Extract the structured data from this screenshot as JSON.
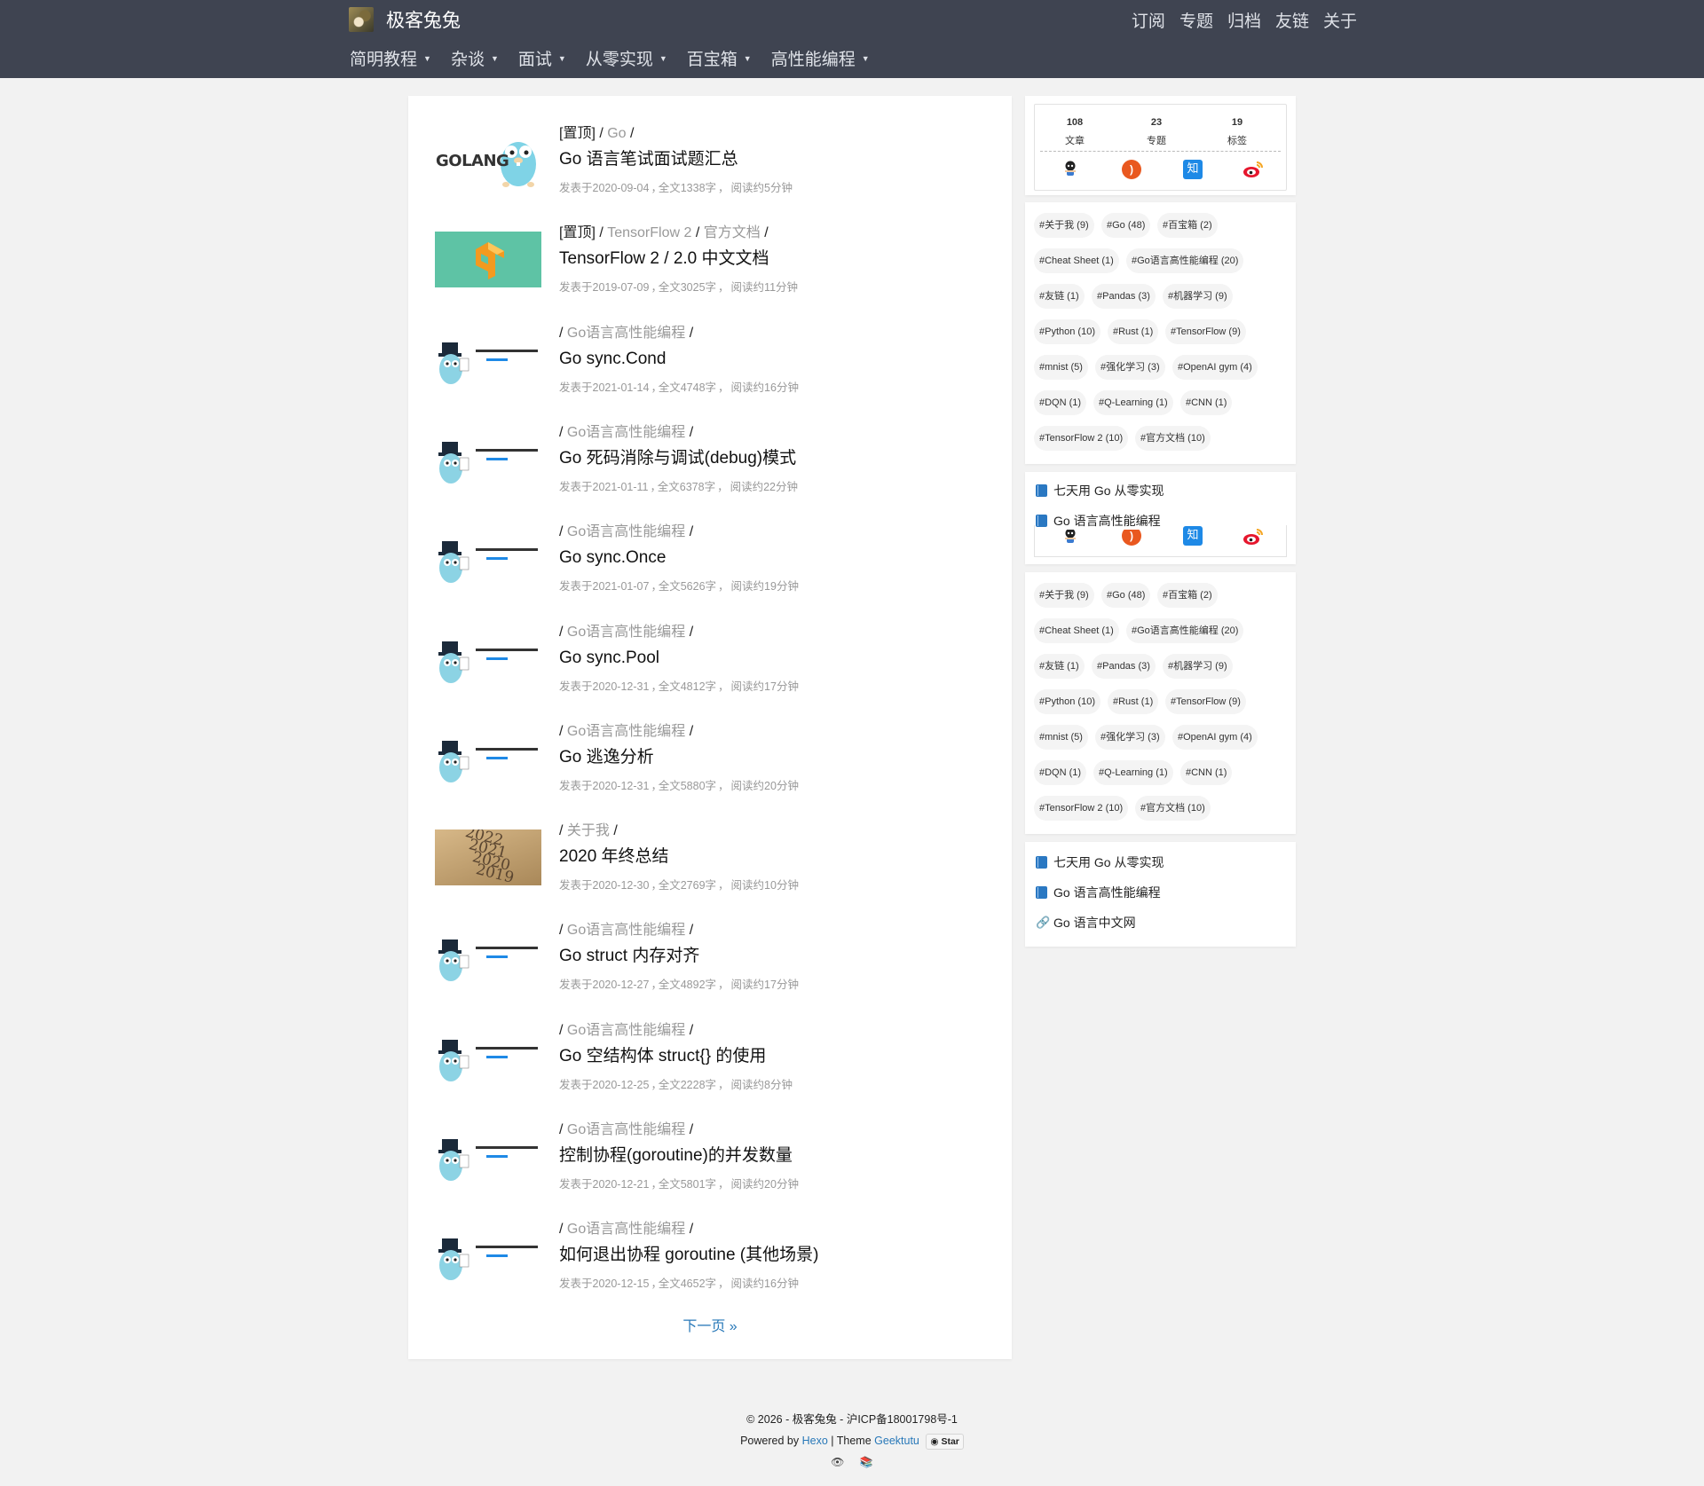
{
  "header": {
    "site_name": "极客兔兔",
    "top_links": [
      "订阅",
      "专题",
      "归档",
      "友链",
      "关于"
    ],
    "menu": [
      "简明教程",
      "杂谈",
      "面试",
      "从零实现",
      "百宝箱",
      "高性能编程"
    ],
    "caret": "▼"
  },
  "posts": [
    {
      "prefix": "[置顶] / ",
      "cats": [
        "Go"
      ],
      "title": "Go 语言笔试面试题汇总",
      "date": "发表于2020-09-04",
      "words": "全文1338字",
      "read": "阅读约5分钟",
      "thumb": "golang",
      "thumb_text": "GOLANG"
    },
    {
      "prefix": "[置顶] / ",
      "cats": [
        "TensorFlow 2",
        "官方文档"
      ],
      "title": "TensorFlow 2 / 2.0 中文文档",
      "date": "发表于2019-07-09",
      "words": "全文3025字",
      "read": "阅读约11分钟",
      "thumb": "tensorflow"
    },
    {
      "prefix": "/ ",
      "cats": [
        "Go语言高性能编程"
      ],
      "title": "Go sync.Cond",
      "date": "发表于2021-01-14",
      "words": "全文4748字",
      "read": "阅读约16分钟",
      "thumb": "geek"
    },
    {
      "prefix": "/ ",
      "cats": [
        "Go语言高性能编程"
      ],
      "title": "Go 死码消除与调试(debug)模式",
      "date": "发表于2021-01-11",
      "words": "全文6378字",
      "read": "阅读约22分钟",
      "thumb": "geek"
    },
    {
      "prefix": "/ ",
      "cats": [
        "Go语言高性能编程"
      ],
      "title": "Go sync.Once",
      "date": "发表于2021-01-07",
      "words": "全文5626字",
      "read": "阅读约19分钟",
      "thumb": "geek"
    },
    {
      "prefix": "/ ",
      "cats": [
        "Go语言高性能编程"
      ],
      "title": "Go sync.Pool",
      "date": "发表于2020-12-31",
      "words": "全文4812字",
      "read": "阅读约17分钟",
      "thumb": "geek"
    },
    {
      "prefix": "/ ",
      "cats": [
        "Go语言高性能编程"
      ],
      "title": "Go 逃逸分析",
      "date": "发表于2020-12-31",
      "words": "全文5880字",
      "read": "阅读约20分钟",
      "thumb": "geek"
    },
    {
      "prefix": "/ ",
      "cats": [
        "关于我"
      ],
      "title": "2020 年终总结",
      "date": "发表于2020-12-30",
      "words": "全文2769字",
      "read": "阅读约10分钟",
      "thumb": "years",
      "thumb_years": [
        "2022",
        "2021",
        "2020",
        "2019"
      ]
    },
    {
      "prefix": "/ ",
      "cats": [
        "Go语言高性能编程"
      ],
      "title": "Go struct 内存对齐",
      "date": "发表于2020-12-27",
      "words": "全文4892字",
      "read": "阅读约17分钟",
      "thumb": "geek"
    },
    {
      "prefix": "/ ",
      "cats": [
        "Go语言高性能编程"
      ],
      "title": "Go 空结构体 struct{} 的使用",
      "date": "发表于2020-12-25",
      "words": "全文2228字",
      "read": "阅读约8分钟",
      "thumb": "geek"
    },
    {
      "prefix": "/ ",
      "cats": [
        "Go语言高性能编程"
      ],
      "title": "控制协程(goroutine)的并发数量",
      "date": "发表于2020-12-21",
      "words": "全文5801字",
      "read": "阅读约20分钟",
      "thumb": "geek"
    },
    {
      "prefix": "/ ",
      "cats": [
        "Go语言高性能编程"
      ],
      "title": "如何退出协程 goroutine (其他场景)",
      "date": "发表于2020-12-15",
      "words": "全文4652字",
      "read": "阅读约16分钟",
      "thumb": "geek"
    }
  ],
  "next_page": "下一页 »",
  "stats": [
    {
      "num": "108",
      "label": "文章"
    },
    {
      "num": "23",
      "label": "专题"
    },
    {
      "num": "19",
      "label": "标签"
    }
  ],
  "social_icons": [
    "github-icon",
    "rss-icon",
    "zhihu-icon",
    "weibo-icon"
  ],
  "zhihu_glyph": "知",
  "tags": [
    "#关于我 (9)",
    "#Go (48)",
    "#百宝箱 (2)",
    "#Cheat Sheet (1)",
    "#Go语言高性能编程 (20)",
    "#友链 (1)",
    "#Pandas (3)",
    "#机器学习 (9)",
    "#Python (10)",
    "#Rust (1)",
    "#TensorFlow (9)",
    "#mnist (5)",
    "#强化学习 (3)",
    "#OpenAI gym (4)",
    "#DQN (1)",
    "#Q-Learning (1)",
    "#CNN (1)",
    "#TensorFlow 2 (10)",
    "#官方文档 (10)"
  ],
  "series_links": [
    "七天用 Go 从零实现",
    "Go 语言高性能编程"
  ],
  "friend_link": "Go 语言中文网",
  "footer": {
    "copyright": "© 2026 - 极客兔兔 - 沪ICP备18001798号-1",
    "powered_by": "Powered by",
    "hexo": "Hexo",
    "theme": "| Theme",
    "theme_name": "Geektutu",
    "star": "Star"
  },
  "colors": {
    "navbar": "#3f4451",
    "link": "#2878b8",
    "rss": "#e9581f",
    "zhihu": "#1e89e6"
  }
}
